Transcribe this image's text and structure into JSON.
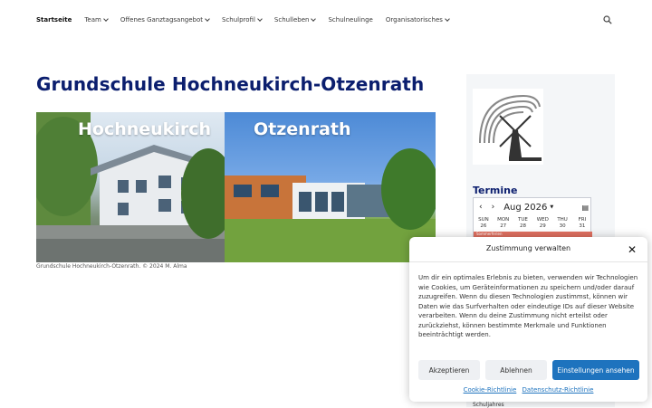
{
  "nav": {
    "items": [
      {
        "label": "Startseite",
        "active": true,
        "dropdown": false
      },
      {
        "label": "Team",
        "active": false,
        "dropdown": true
      },
      {
        "label": "Offenes Ganztagsangebot",
        "active": false,
        "dropdown": true
      },
      {
        "label": "Schulprofil",
        "active": false,
        "dropdown": true
      },
      {
        "label": "Schulleben",
        "active": false,
        "dropdown": true
      },
      {
        "label": "Schulneulinge",
        "active": false,
        "dropdown": false
      },
      {
        "label": "Organisatorisches",
        "active": false,
        "dropdown": true
      }
    ],
    "search_icon": "search-icon"
  },
  "main": {
    "title": "Grundschule Hochneukirch-Otzenrath",
    "hero_left_label": "Hochneukirch",
    "hero_right_label": "Otzenrath",
    "caption": "Grundschule Hochneukirch-Otzenrath. © 2024 M. Alma"
  },
  "sidebar": {
    "termine_title": "Termine",
    "calendar": {
      "month": "Aug 2026",
      "days": [
        {
          "name": "SUN",
          "num": "26"
        },
        {
          "name": "MON",
          "num": "27"
        },
        {
          "name": "TUE",
          "num": "28"
        },
        {
          "name": "WED",
          "num": "29"
        },
        {
          "name": "THU",
          "num": "30"
        },
        {
          "name": "FRI",
          "num": "31"
        }
      ],
      "event": "Sommerferien"
    },
    "footer_text": "Schuljahres"
  },
  "cookie": {
    "title": "Zustimmung verwalten",
    "text": "Um dir ein optimales Erlebnis zu bieten, verwenden wir Technologien wie Cookies, um Geräteinformationen zu speichern und/oder darauf zuzugreifen. Wenn du diesen Technologien zustimmst, können wir Daten wie das Surfverhalten oder eindeutige IDs auf dieser Website verarbeiten. Wenn du deine Zustimmung nicht erteilst oder zurückziehst, können bestimmte Merkmale und Funktionen beeinträchtigt werden.",
    "accept_label": "Akzeptieren",
    "deny_label": "Ablehnen",
    "settings_label": "Einstellungen ansehen",
    "link_cookie": "Cookie-Richtlinie",
    "link_privacy": "Datenschutz-Richtlinie"
  },
  "colors": {
    "title": "#0b1e6e",
    "primary_button": "#1e73be"
  }
}
